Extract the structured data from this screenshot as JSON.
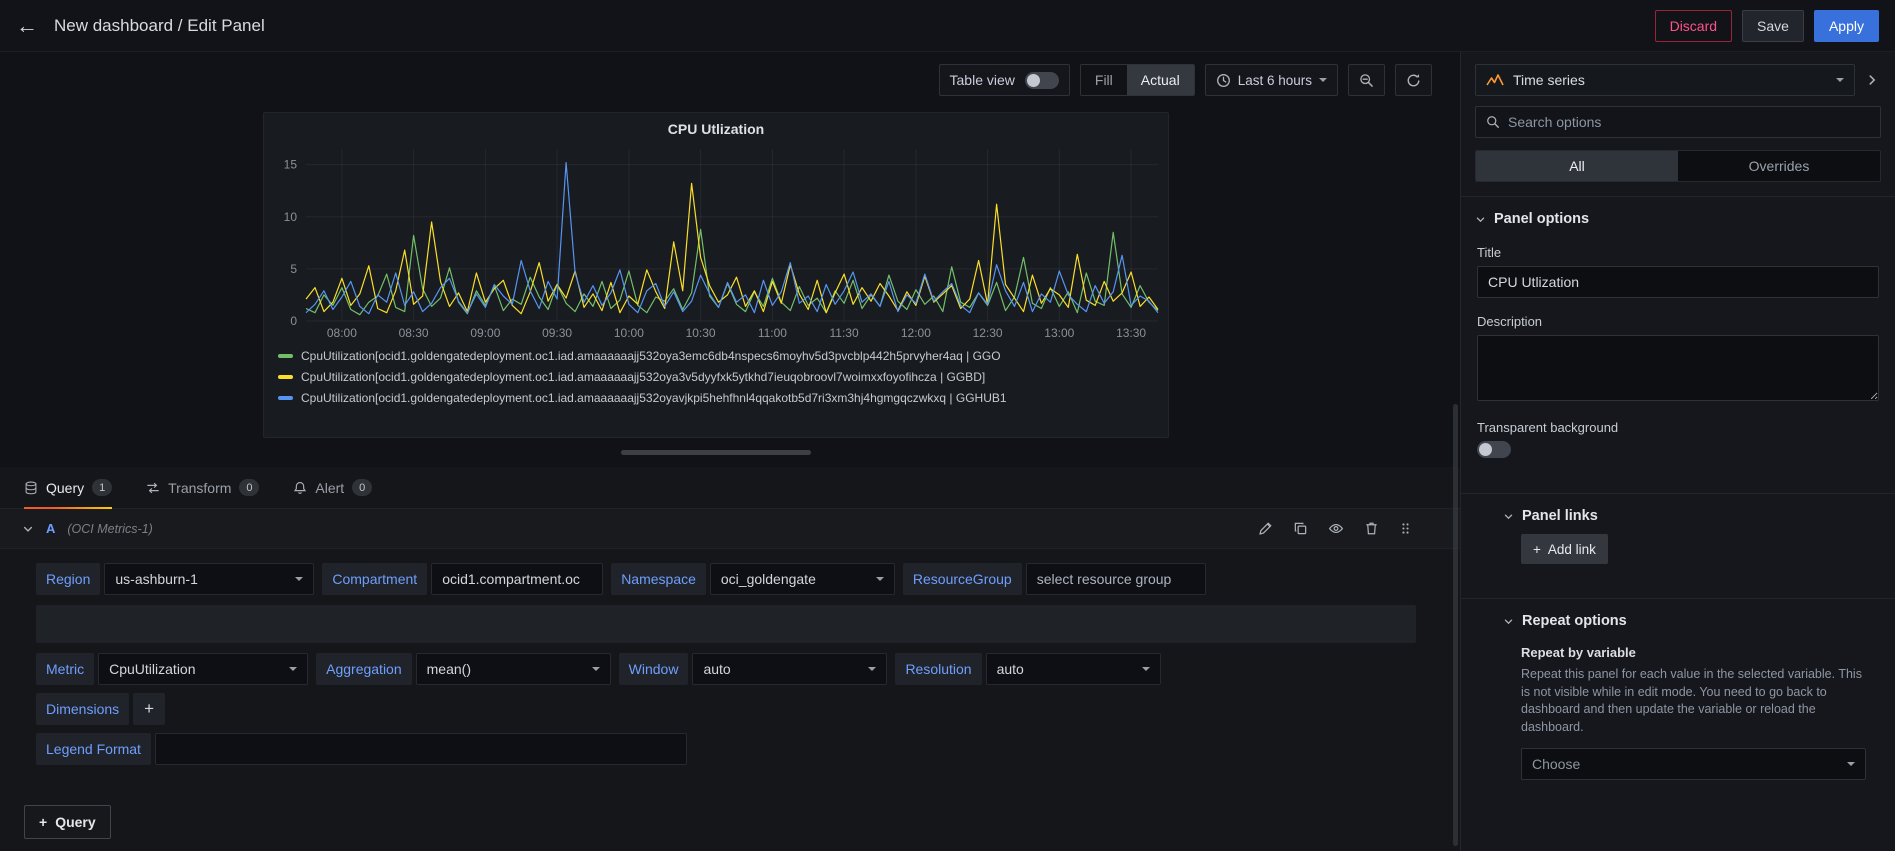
{
  "header": {
    "title": "New dashboard / Edit Panel",
    "discard_label": "Discard",
    "save_label": "Save",
    "apply_label": "Apply"
  },
  "toolbar": {
    "table_view_label": "Table view",
    "fill_label": "Fill",
    "actual_label": "Actual",
    "time_range_label": "Last 6 hours"
  },
  "chart_data": {
    "type": "line",
    "title": "CPU Utlization",
    "xlabel": "",
    "ylabel": "",
    "ylim": [
      0,
      16.5
    ],
    "y_ticks": [
      0,
      5,
      10,
      15
    ],
    "x_tick_labels": [
      "08:00",
      "08:30",
      "09:00",
      "09:30",
      "10:00",
      "10:30",
      "11:00",
      "11:30",
      "12:00",
      "12:30",
      "13:00",
      "13:30"
    ],
    "grid": true,
    "legend_position": "bottom",
    "series": [
      {
        "name": "CpuUtilization[ocid1.goldengatedeployment.oc1.iad.amaaaaaajj532oya3emc6db4nspecs6moyhv5d3pvcblp442h5prvyher4aq | GGO",
        "color": "#73bf69",
        "values": [
          1.2,
          0.8,
          2.5,
          1.5,
          3.2,
          1.1,
          0.6,
          1.8,
          2.4,
          4.5,
          1.3,
          0.9,
          8.2,
          3.1,
          1.4,
          2.2,
          5.1,
          1.8,
          0.7,
          2.9,
          1.5,
          3.4,
          1.0,
          2.1,
          1.6,
          4.2,
          2.3,
          1.1,
          3.5,
          1.7,
          0.9,
          2.6,
          1.4,
          3.8,
          1.2,
          2.0,
          4.8,
          1.5,
          0.8,
          2.3,
          1.9,
          3.1,
          1.1,
          2.7,
          8.8,
          2.4,
          1.3,
          3.6,
          1.6,
          0.9,
          2.8,
          1.4,
          4.1,
          1.8,
          1.0,
          3.3,
          1.5,
          2.2,
          0.8,
          2.9,
          1.7,
          3.9,
          1.2,
          2.5,
          1.4,
          4.4,
          1.9,
          1.1,
          3.0,
          1.6,
          2.4,
          0.9,
          5.2,
          1.8,
          1.3,
          2.7,
          1.5,
          3.7,
          1.0,
          2.3,
          6.1,
          1.7,
          1.2,
          3.2,
          1.4,
          2.8,
          0.8,
          4.6,
          1.9,
          1.5,
          8.5,
          2.6,
          1.3,
          3.4,
          1.8,
          1.0
        ]
      },
      {
        "name": "CpuUtilization[ocid1.goldengatedeployment.oc1.iad.amaaaaaajj532oya3v5dyyfxk5ytkhd7ieuqobroovl7woimxxfoyofihcza | GGBD]",
        "color": "#fade2a",
        "values": [
          2.1,
          3.2,
          0.9,
          1.8,
          4.1,
          1.5,
          2.6,
          5.3,
          1.2,
          0.8,
          2.9,
          6.8,
          1.6,
          2.4,
          9.5,
          3.8,
          1.4,
          2.7,
          0.9,
          4.6,
          1.8,
          3.1,
          3.9,
          1.5,
          0.7,
          2.8,
          5.6,
          1.9,
          3.5,
          2.2,
          4.8,
          1.3,
          2.6,
          1.0,
          3.7,
          0.8,
          2.4,
          1.6,
          4.9,
          2.8,
          1.2,
          7.6,
          2.9,
          13.2,
          6.1,
          3.4,
          1.8,
          2.5,
          4.2,
          1.4,
          2.9,
          0.9,
          3.8,
          1.7,
          5.4,
          2.6,
          1.1,
          3.9,
          0.8,
          2.7,
          4.5,
          1.6,
          3.2,
          1.9,
          3.6,
          2.4,
          1.0,
          2.8,
          1.5,
          4.3,
          1.8,
          2.6,
          3.4,
          1.2,
          2.1,
          5.8,
          1.6,
          11.2,
          3.5,
          2.2,
          0.9,
          4.4,
          1.7,
          3.1,
          2.5,
          1.3,
          6.4,
          2.0,
          1.5,
          3.8,
          1.9,
          2.7,
          4.7,
          1.4,
          2.3,
          1.1
        ]
      },
      {
        "name": "CpuUtilization[ocid1.goldengatedeployment.oc1.iad.amaaaaaajj532oyavjkpi5hehfhnl4qqakotb5d7ri3xm3hj4hgmgqczwkxq | GGHUB1",
        "color": "#5794f2",
        "values": [
          0.8,
          1.6,
          2.9,
          1.1,
          2.3,
          3.8,
          1.4,
          0.7,
          2.5,
          1.8,
          4.6,
          1.5,
          2.8,
          0.9,
          1.7,
          3.2,
          4.1,
          1.9,
          0.8,
          2.6,
          1.3,
          3.5,
          2.4,
          1.6,
          5.8,
          2.9,
          1.2,
          3.8,
          2.1,
          15.2,
          4.6,
          1.8,
          3.4,
          1.5,
          2.7,
          4.9,
          1.6,
          0.8,
          2.9,
          3.6,
          1.4,
          2.8,
          0.9,
          1.9,
          4.4,
          2.6,
          1.3,
          3.7,
          1.8,
          2.5,
          0.8,
          3.9,
          1.5,
          2.8,
          5.6,
          1.7,
          2.4,
          0.9,
          3.5,
          1.6,
          2.9,
          4.7,
          1.8,
          2.6,
          1.4,
          3.8,
          0.9,
          2.5,
          1.7,
          4.5,
          1.9,
          2.8,
          3.6,
          1.5,
          0.8,
          2.7,
          1.6,
          5.4,
          2.9,
          1.4,
          3.7,
          0.9,
          2.6,
          1.8,
          4.8,
          2.5,
          1.6,
          0.9,
          3.4,
          1.7,
          2.8,
          6.3,
          1.5,
          2.4,
          1.9,
          0.8
        ]
      }
    ]
  },
  "editor": {
    "tabs": [
      {
        "label": "Query",
        "badge": "1"
      },
      {
        "label": "Transform",
        "badge": "0"
      },
      {
        "label": "Alert",
        "badge": "0"
      }
    ],
    "query_row": {
      "ref_id": "A",
      "datasource": "(OCI Metrics-1)"
    },
    "form": {
      "region_label": "Region",
      "region_value": "us-ashburn-1",
      "compartment_label": "Compartment",
      "compartment_value": "ocid1.compartment.oc",
      "namespace_label": "Namespace",
      "namespace_value": "oci_goldengate",
      "resourcegroup_label": "ResourceGroup",
      "resourcegroup_placeholder": "select resource group",
      "metric_label": "Metric",
      "metric_value": "CpuUtilization",
      "aggregation_label": "Aggregation",
      "aggregation_value": "mean()",
      "window_label": "Window",
      "window_value": "auto",
      "resolution_label": "Resolution",
      "resolution_value": "auto",
      "dimensions_label": "Dimensions",
      "legend_format_label": "Legend Format"
    },
    "add_query_label": "Query"
  },
  "sidebar": {
    "viz_type": "Time series",
    "search_placeholder": "Search options",
    "tab_all": "All",
    "tab_overrides": "Overrides",
    "panel_options": {
      "title": "Panel options",
      "title_label": "Title",
      "title_value": "CPU Utlization",
      "description_label": "Description",
      "transparent_label": "Transparent background"
    },
    "panel_links": {
      "title": "Panel links",
      "add_link_label": "Add link"
    },
    "repeat_options": {
      "title": "Repeat options",
      "repeat_label": "Repeat by variable",
      "repeat_help": "Repeat this panel for each value in the selected variable. This is not visible while in edit mode. You need to go back to dashboard and then update the variable or reload the dashboard.",
      "choose_placeholder": "Choose"
    }
  },
  "icons": {
    "plus": "+",
    "back_arrow": "←"
  },
  "colors": {
    "apply_blue": "#3871dc",
    "discard_red": "#e02f44",
    "label_blue": "#6e9fff",
    "tab_active_orange": "#f05a28",
    "series_green": "#73bf69",
    "series_yellow": "#fade2a",
    "series_blue": "#5794f2"
  }
}
